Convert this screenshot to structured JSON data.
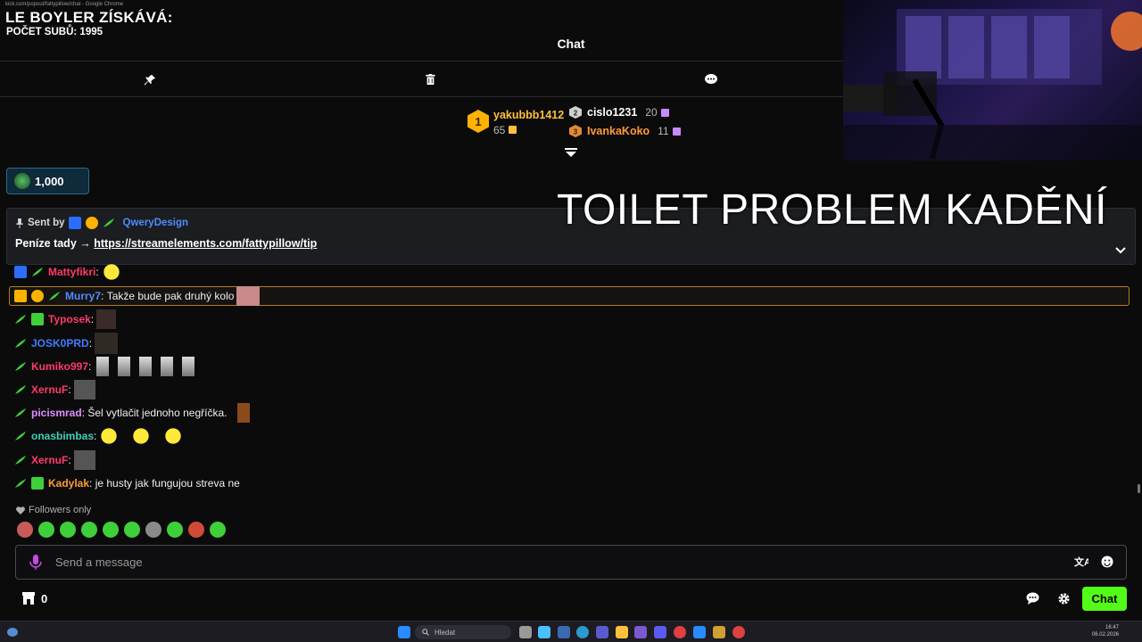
{
  "browser": {
    "title": "kick.com/popout/fattypillow/chat - Google Chrome"
  },
  "overlay": {
    "title": "LE BOYLER ZÍSKÁVÁ:",
    "subs": "POČET SUBŮ: 1995",
    "banner": "TOILET PROBLEM KADĚNÍ"
  },
  "chat": {
    "title": "Chat"
  },
  "toolbar": {
    "icons": [
      "pin-icon",
      "trash-icon",
      "chat-bubble-icon"
    ]
  },
  "leaderboard": {
    "first": {
      "rank": "1",
      "name": "yakubbb1412",
      "count": "65"
    },
    "second": {
      "name": "cislo1231",
      "count": "20"
    },
    "third": {
      "name": "IvankaKoko",
      "count": "11"
    }
  },
  "points": {
    "value": "1,000"
  },
  "pinned": {
    "sent_by": "Sent by",
    "sender": "QweryDesign",
    "text": "Peníze tady → ",
    "link": "https://streamelements.com/fattypillow/tip"
  },
  "messages": [
    {
      "user": "Mattyfikri",
      "color": "#ff3a6a",
      "text": ""
    },
    {
      "user": "Murry7",
      "color": "#4f8cff",
      "text": "Takže bude pak druhý kolo"
    },
    {
      "user": "Typosek",
      "color": "#ff3a6a",
      "text": ""
    },
    {
      "user": "JOSK0PRD",
      "color": "#3f7cff",
      "text": ""
    },
    {
      "user": "Kumiko997",
      "color": "#ff3a6a",
      "text": ""
    },
    {
      "user": "XernuF",
      "color": "#ff3a6a",
      "text": ""
    },
    {
      "user": "picismrad",
      "color": "#e08bff",
      "text": "Šel vytlačit jednoho negříčka."
    },
    {
      "user": "onasbimbas",
      "color": "#3fd0b8",
      "text": ""
    },
    {
      "user": "XernuF",
      "color": "#ff3a6a",
      "text": ""
    },
    {
      "user": "Kadylak",
      "color": "#ff9a3a",
      "text": "je husty jak fungujou streva ne"
    }
  ],
  "followers_only": "Followers only",
  "input": {
    "placeholder": "Send a message"
  },
  "footer": {
    "store_count": "0",
    "chat_button": "Chat"
  },
  "taskbar": {
    "search": "Hledat",
    "time": "16:47",
    "date": "06.02.2026"
  },
  "colors": {
    "accent": "#53fc18",
    "gold": "#ffc13b"
  }
}
